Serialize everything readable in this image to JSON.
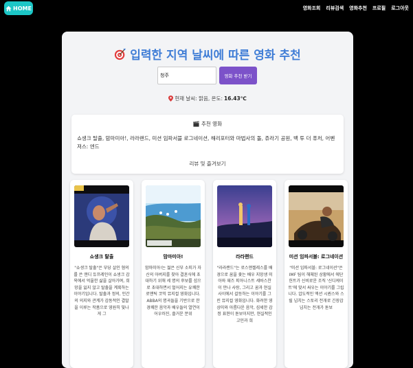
{
  "nav": {
    "home_label": "HOME",
    "links": [
      "영화조회",
      "리뷰검색",
      "영화추천",
      "프로필",
      "로그아웃"
    ]
  },
  "page": {
    "title": "입력한 지역 날씨에 따른 영화 추천",
    "search_value": "청주",
    "search_button": "영화 추천 받기",
    "weather_text": "현재 날씨: 맑음, 온도:",
    "weather_temp": "16.43℃"
  },
  "recommendation": {
    "heading": "추천 영화",
    "list_text": "쇼생크 탈출, 맘마미아!, 라라랜드, 미션 임파서블 로그네이션, 해리포터와 마법사의 돌, 쥬라기 공원, 백 투 더 퓨처, 어벤져스: 엔드",
    "review_link": "리뷰 및 즐겨보기"
  },
  "cards": [
    {
      "title": "쇼생크 탈출",
      "desc": "\"쇼생크 탈출\"은 부당 살인 혐의를 쓴 앤디 듀프레인이 쇼생크 감옥에서 억울한 삶을 살아가며, 희망을 잃지 않고 탈출을 계획하는 이야기입니다. 탈출과 정의, 인간의 의지와 관계가 감동적인 결말을 이루는 작품으로 영원히 빛나게 그"
    },
    {
      "title": "맘마미아!",
      "desc": "맘마미아!는 젊은 신부 소피가 자신의 아버지를 찾아 결혼식에 초대하기 위해 세 명의 후보를 섬으로 초대하면서 벌어지는 유쾌한 로맨틱 코믹 뮤지컬 영화입니다. ABBA의 명곡들을 기반으로 한 경쾌한 음악과 배우들의 열연이 어우러진, 즐거운 분위"
    },
    {
      "title": "라라랜드",
      "desc": "\"라라랜드\"는 로스앤젤레스를 배경으로 꿈을 좇는 배우 지망생 미아와 재즈 피아니스트 세바스찬이 만나 사랑, 그리고 꿈과 현실 사이에서 갈등하는 이야기를 그린 뮤지컬 영화입니다. 화려한 영상미와 아름다운 음악, 섬세한 감정 표현이 돋보이지만, 현실적인 고민과 희"
    },
    {
      "title": "미션 임파서블: 로그네이션",
      "desc": "\"미션 임파서블: 로그네이션\"은 IMF 팀이 해체된 상황에서 에단 헌트가 신비로운 조직 '신디케이트'에 맞서 싸우는 이야기를 그립니다. 압도적인 액션 시퀀스와 스릴 넘치는 스토리 전개로 긴장감 넘치는 전개가 돋보"
    }
  ]
}
